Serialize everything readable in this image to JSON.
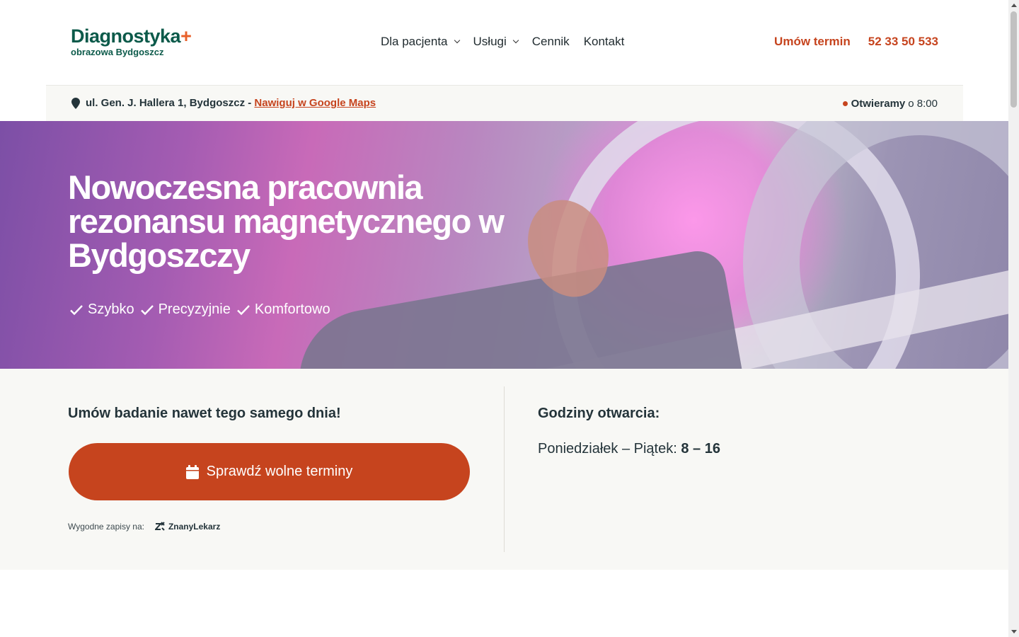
{
  "header": {
    "logo_main": "Diagnostyka",
    "logo_plus": "+",
    "logo_sub": "obrazowa Bydgoszcz",
    "nav": [
      {
        "label": "Dla pacjenta",
        "dropdown": true
      },
      {
        "label": "Usługi",
        "dropdown": true
      },
      {
        "label": "Cennik",
        "dropdown": false
      },
      {
        "label": "Kontakt",
        "dropdown": false
      }
    ],
    "book_label": "Umów termin",
    "phone": "52 33 50 533"
  },
  "infobar": {
    "address": "ul. Gen. J. Hallera 1, Bydgoszcz -",
    "maps_link": "Nawiguj w Google Maps",
    "open_status": "Otwieramy",
    "open_time": "o 8:00"
  },
  "hero": {
    "title": "Nowoczesna pracownia rezonansu magnetycznego w Bydgoszczy",
    "checks": [
      "Szybko",
      "Precyzyjnie",
      "Komfortowo"
    ]
  },
  "booking": {
    "title": "Umów badanie nawet tego samego dnia!",
    "cta_label": "Sprawdź wolne terminy",
    "zapisy_label": "Wygodne zapisy na:",
    "partner": "ZnanyLekarz"
  },
  "hours": {
    "title": "Godziny otwarcia:",
    "days": "Poniedziałek – Piątek:",
    "time": "8 – 16"
  },
  "colors": {
    "brand_green": "#0c5a4a",
    "accent_orange": "#c6441e",
    "section_bg": "#f8f8f5"
  }
}
